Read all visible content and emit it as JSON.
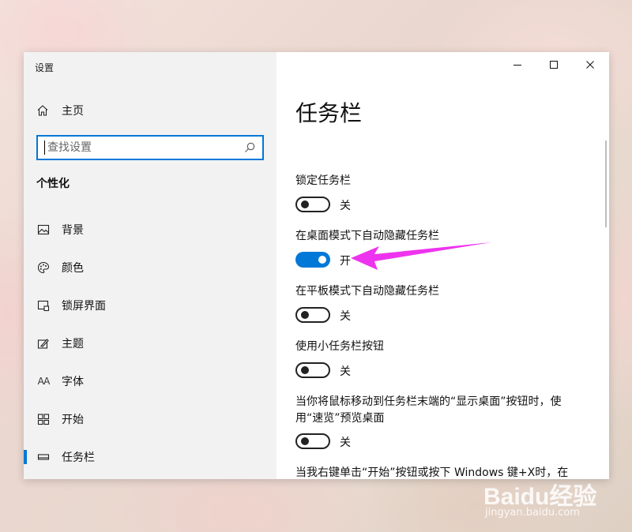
{
  "window": {
    "title": "设置"
  },
  "sidebar": {
    "home_label": "主页",
    "search": {
      "value": "",
      "placeholder": "查找设置"
    },
    "section_title": "个性化",
    "items": [
      {
        "label": "背景",
        "icon": "picture-icon"
      },
      {
        "label": "颜色",
        "icon": "palette-icon"
      },
      {
        "label": "锁屏界面",
        "icon": "lock-screen-icon"
      },
      {
        "label": "主题",
        "icon": "theme-icon"
      },
      {
        "label": "字体",
        "icon": "font-icon"
      },
      {
        "label": "开始",
        "icon": "start-icon"
      },
      {
        "label": "任务栏",
        "icon": "taskbar-icon",
        "selected": true
      }
    ]
  },
  "content": {
    "page_title": "任务栏",
    "settings": [
      {
        "label": "锁定任务栏",
        "state": "关",
        "on": false
      },
      {
        "label": "在桌面模式下自动隐藏任务栏",
        "state": "开",
        "on": true
      },
      {
        "label": "在平板模式下自动隐藏任务栏",
        "state": "关",
        "on": false
      },
      {
        "label": "使用小任务栏按钮",
        "state": "关",
        "on": false
      },
      {
        "label": "当你将鼠标移动到任务栏末端的“显示桌面”按钮时，使用“速览”预览桌面",
        "state": "关",
        "on": false
      },
      {
        "label": "当我右键单击“开始”按钮或按下 Windows 键+X时，在"
      }
    ]
  },
  "watermark": {
    "brand": "Baidu经验",
    "url": "jingyan.baidu.com"
  },
  "colors": {
    "accent": "#0078d7",
    "arrow": "#ee33ee",
    "sidebar_bg": "#f2f2f2"
  }
}
